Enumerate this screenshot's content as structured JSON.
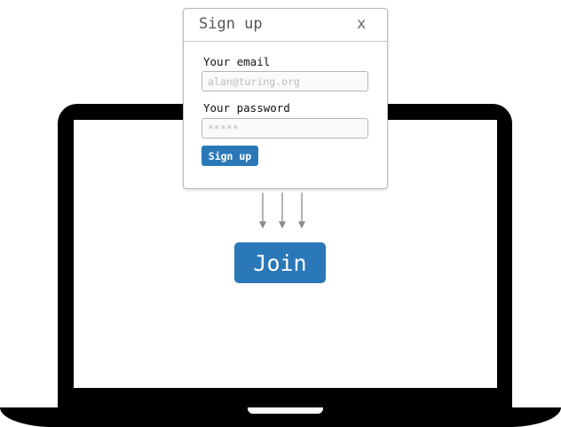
{
  "modal": {
    "title": "Sign up",
    "close_label": "x",
    "email_label": "Your email",
    "email_placeholder": "alan@turing.org",
    "password_label": "Your password",
    "password_placeholder": "*****",
    "submit_label": "Sign up"
  },
  "screen": {
    "join_label": "Join"
  },
  "colors": {
    "accent": "#2b78b8",
    "laptop": "#000000",
    "arrow": "#8a8a8a"
  }
}
